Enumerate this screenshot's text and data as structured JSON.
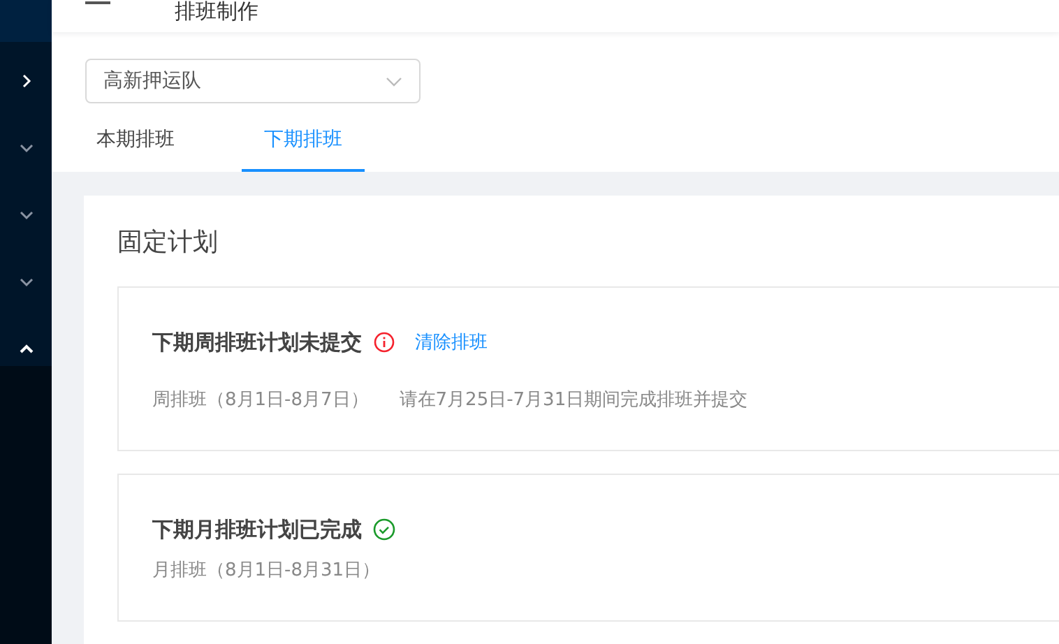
{
  "header": {
    "title": "排班制作"
  },
  "sidebar": {
    "items": [
      {
        "kind": "toggle",
        "expanded": false
      },
      {
        "kind": "submenu",
        "expanded": false
      },
      {
        "kind": "submenu",
        "expanded": false
      },
      {
        "kind": "submenu",
        "expanded": false
      },
      {
        "kind": "submenu",
        "expanded": true
      }
    ]
  },
  "team_select": {
    "value": "高新押运队"
  },
  "tabs": [
    {
      "label": "本期排班",
      "selected": false
    },
    {
      "label": "下期排班",
      "selected": true
    }
  ],
  "panel": {
    "title": "固定计划",
    "plans": [
      {
        "title": "下期周排班计划未提交",
        "done": false,
        "action": "清除排班",
        "details": [
          "周排班（8月1日-8月7日）",
          "请在7月25日-7月31日期间完成排班并提交"
        ]
      },
      {
        "title": "下期月排班计划已完成",
        "done": true,
        "details": [
          "月排班（8月1日-8月31日）"
        ]
      }
    ]
  }
}
